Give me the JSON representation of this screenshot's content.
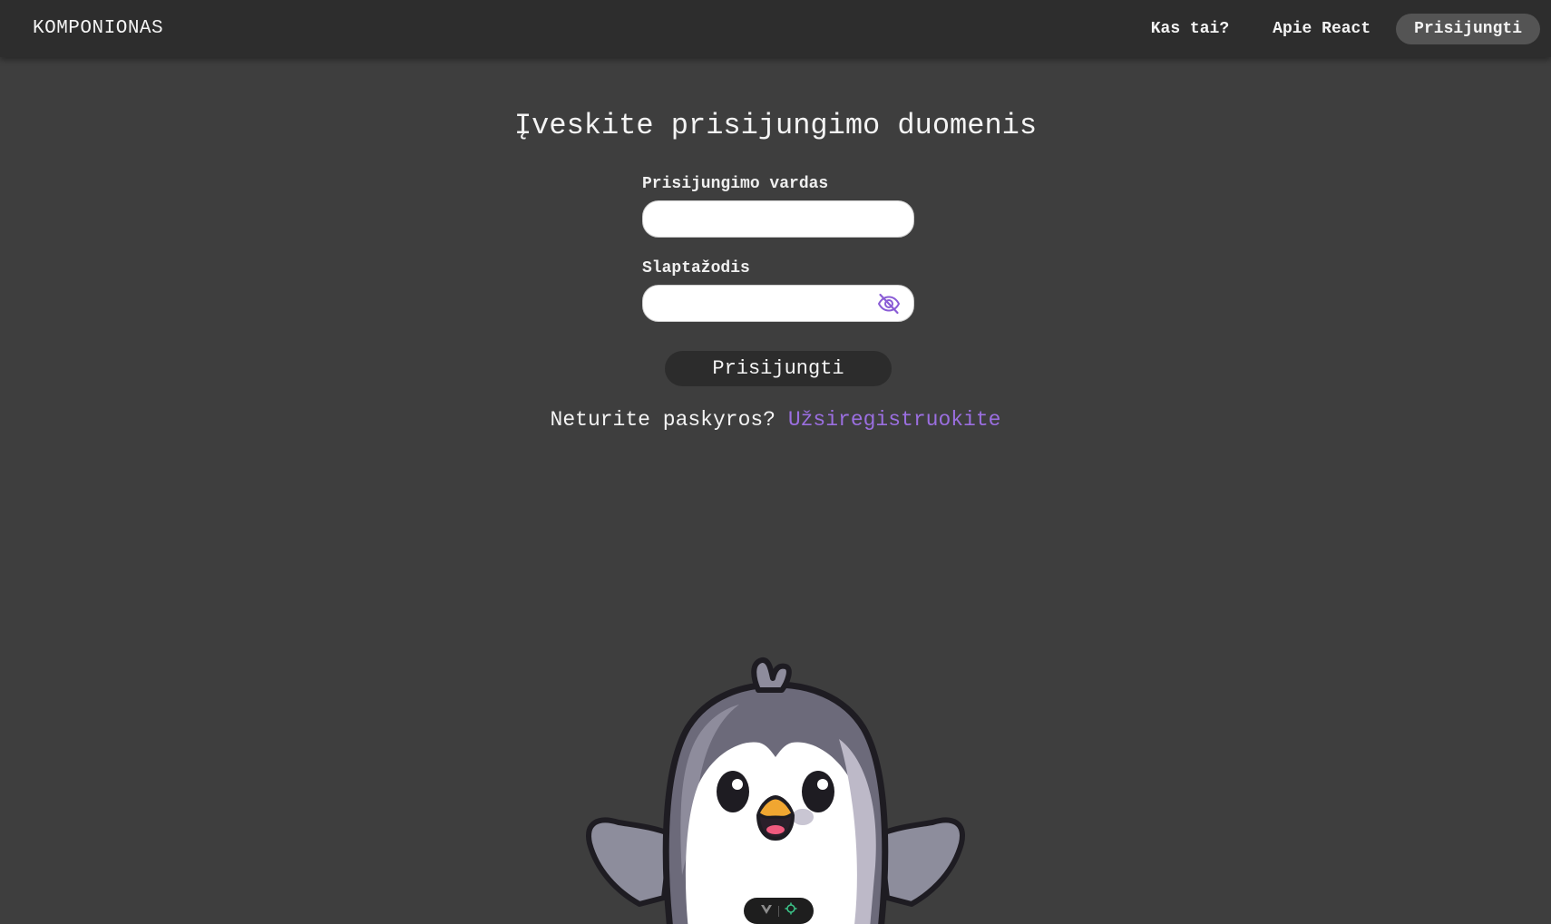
{
  "navbar": {
    "brand": "KOMPONIONAS",
    "links": [
      {
        "label": "Kas tai?"
      },
      {
        "label": "Apie React"
      },
      {
        "label": "Prisijungti",
        "active": true
      }
    ]
  },
  "login": {
    "title": "Įveskite prisijungimo duomenis",
    "username_label": "Prisijungimo vardas",
    "username_value": "",
    "password_label": "Slaptažodis",
    "password_value": "",
    "toggle_icon": "eye-off-icon",
    "submit_label": "Prisijungti",
    "register_prompt": "Neturite paskyros?",
    "register_link": "Užsiregistruokite"
  },
  "colors": {
    "background": "#3e3e3e",
    "navbar": "#2d2d2d",
    "accent": "#9b6fe0",
    "button": "#2c2c2c"
  },
  "mascot": {
    "icon": "penguin-illustration"
  },
  "devtools": {
    "icons": [
      "vue-devtools-icon",
      "inspector-target-icon"
    ]
  }
}
